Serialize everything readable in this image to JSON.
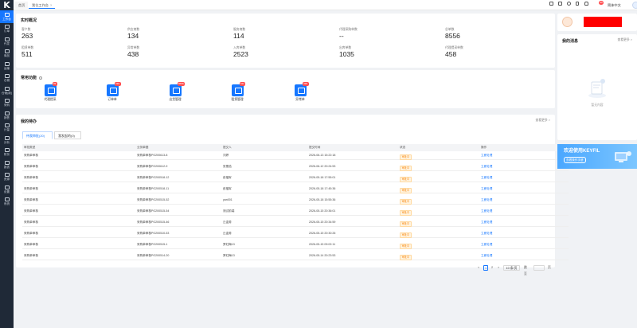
{
  "sidebar": {
    "logo": "K",
    "items": [
      {
        "label": "工作台",
        "active": true
      },
      {
        "label": "订单"
      },
      {
        "label": "代发"
      },
      {
        "label": "商品"
      },
      {
        "label": "运输"
      },
      {
        "label": "仓储"
      },
      {
        "label": "仓储(新)"
      },
      {
        "label": "采购"
      },
      {
        "label": "销售"
      },
      {
        "label": "计量"
      },
      {
        "label": "分析"
      },
      {
        "label": "财务"
      },
      {
        "label": "报表"
      },
      {
        "label": "资源"
      },
      {
        "label": "设置"
      },
      {
        "label": "系统"
      }
    ]
  },
  "topbar": {
    "tabs": [
      "首页",
      "我位工作台"
    ],
    "tab_close": "×",
    "badge": "99",
    "lang": "简体中文",
    "caret": "▾"
  },
  "overview": {
    "title": "实时概况",
    "stats": [
      {
        "label": "客户数",
        "value": "263"
      },
      {
        "label": "供应商数",
        "value": "134"
      },
      {
        "label": "服务商数",
        "value": "114"
      },
      {
        "label": "代理采购单数",
        "value": "--"
      },
      {
        "label": "总单数",
        "value": "8556"
      },
      {
        "label": "租赁单数",
        "value": "511"
      },
      {
        "label": "异常单数",
        "value": "438"
      },
      {
        "label": "入库单数",
        "value": "2523"
      },
      {
        "label": "出库单数",
        "value": "1035"
      },
      {
        "label": "代理提采单数",
        "value": "458"
      }
    ]
  },
  "functions": {
    "title": "常用功能",
    "items": [
      {
        "label": "代理提采",
        "badge": "99"
      },
      {
        "label": "订单单",
        "badge": "236"
      },
      {
        "label": "出货管理",
        "badge": "8556"
      },
      {
        "label": "租赁管理",
        "badge": "511"
      },
      {
        "label": "异常单",
        "badge": "438"
      }
    ]
  },
  "todo": {
    "title": "我的待办",
    "more": "查看更多 >",
    "tabs": [
      "待我审批(20)",
      "我发起的(0)"
    ],
    "columns": [
      "审批类型",
      "业务单据",
      "提交人",
      "提交时间",
      "状态",
      "操作"
    ],
    "rows": [
      [
        "采购单审核",
        "采购单审核PO200613-8",
        "刘婷",
        "2026-06-13 15:22:18",
        "审批中",
        "立即处理"
      ],
      [
        "采购单审核",
        "采购单审核PO200612-9",
        "张雪浩",
        "2026-06-12 20:24:53",
        "审批中",
        "立即处理"
      ],
      [
        "采购单审核",
        "采购单审核PO200518-12",
        "彭福军",
        "2026-05-18 17:55:01",
        "审批中",
        "立即处理"
      ],
      [
        "采购单审核",
        "采购单审核PO200518-11",
        "彭福军",
        "2026-05-18 17:45:36",
        "审批中",
        "立即处理"
      ],
      [
        "采购单审核",
        "采购单审核PO200515-52",
        "yan001",
        "2026-05-18 15:55:36",
        "审批中",
        "立即处理"
      ],
      [
        "采购单审核",
        "采购单审核PO200515-54",
        "测试前端",
        "2026-05-15 20:36:01",
        "审批中",
        "立即处理"
      ],
      [
        "采购单审核",
        "采购单审核PO200515-46",
        "丘金秀",
        "2026-05-15 20:34:59",
        "审批中",
        "立即处理"
      ],
      [
        "采购单审核",
        "采购单审核PO200510-53",
        "丘金秀",
        "2026-05-15 20:30:26",
        "审批中",
        "立即处理"
      ],
      [
        "采购单审核",
        "采购单审核PO200515-1",
        "罗红梅13",
        "2026-05-15 09:02:11",
        "审批中",
        "立即处理"
      ],
      [
        "采购单审核",
        "采购单审核PO200514-20",
        "罗红梅13",
        "2026-05-14 20:23:53",
        "审批中",
        "立即处理"
      ]
    ],
    "pager": {
      "prev": "<",
      "page1": "1",
      "page2": "2",
      "next": ">",
      "size": "10 条/页",
      "goto": "跳至",
      "unit": "页"
    }
  },
  "messages": {
    "title": "我的消息",
    "more": "查看更多 >",
    "empty": "暂无内容"
  },
  "ad": {
    "title": "欢迎使用KEYFIL",
    "button": "查看操作手册"
  },
  "colors": {
    "primary": "#1677ff",
    "sidebar": "#1f2937",
    "danger": "#ff4d4f",
    "warning": "#fa8c16"
  }
}
